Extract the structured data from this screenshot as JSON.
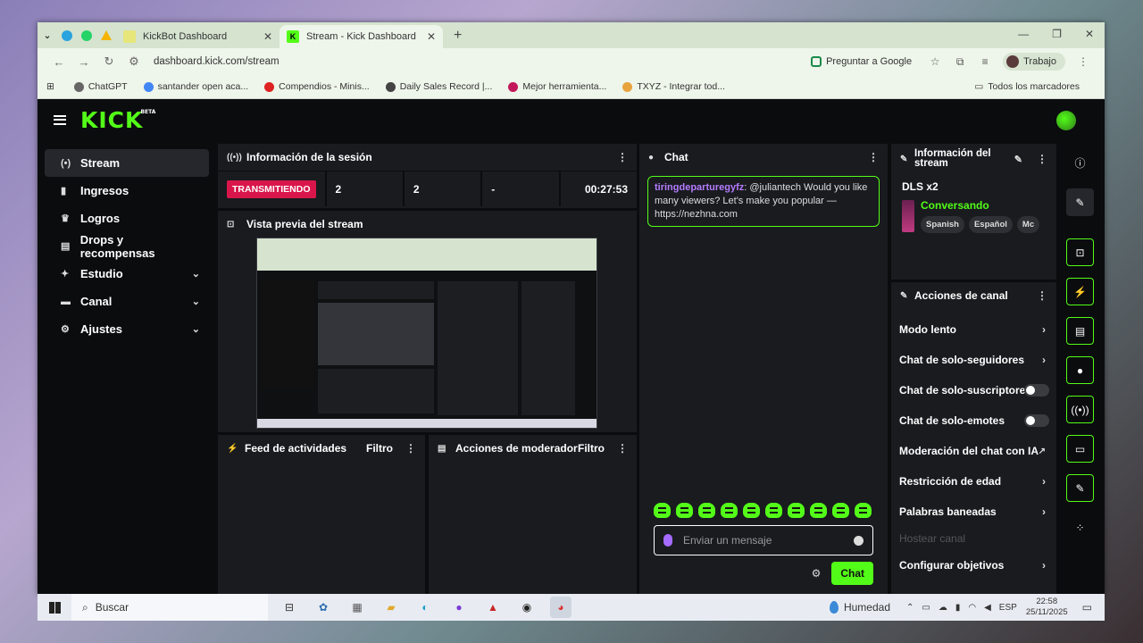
{
  "browser": {
    "tabs": [
      {
        "title": "KickBot Dashboard",
        "active": false
      },
      {
        "title": "Stream - Kick Dashboard",
        "active": true
      }
    ],
    "url": "dashboard.kick.com/stream",
    "ask_google": "Preguntar a Google",
    "profile": "Trabajo",
    "bookmarks": [
      "ChatGPT",
      "santander open aca...",
      "Compendios - Minis...",
      "Daily Sales Record |...",
      "Mejor herramienta...",
      "TXYZ - Integrar tod..."
    ],
    "all_bookmarks": "Todos los marcadores"
  },
  "kick": {
    "logo": "KICK",
    "logo_badge": "BETA",
    "sidebar": [
      {
        "label": "Stream",
        "icon": "broadcast-icon",
        "glyph": "(•)",
        "active": true,
        "expandable": false
      },
      {
        "label": "Ingresos",
        "icon": "chart-icon",
        "glyph": "▮",
        "active": false,
        "expandable": false
      },
      {
        "label": "Logros",
        "icon": "trophy-icon",
        "glyph": "♛",
        "active": false,
        "expandable": false
      },
      {
        "label": "Drops y recompensas",
        "icon": "gift-icon",
        "glyph": "▤",
        "active": false,
        "expandable": false
      },
      {
        "label": "Estudio",
        "icon": "studio-icon",
        "glyph": "✦",
        "active": false,
        "expandable": true
      },
      {
        "label": "Canal",
        "icon": "channel-icon",
        "glyph": "▬",
        "active": false,
        "expandable": true
      },
      {
        "label": "Ajustes",
        "icon": "settings-icon",
        "glyph": "⚙",
        "active": false,
        "expandable": true
      }
    ],
    "session": {
      "title": "Información de la sesión",
      "status": "TRANSMITIENDO",
      "viewers": "2",
      "followers": "2",
      "extra": "-",
      "duration": "00:27:53"
    },
    "preview": {
      "title": "Vista previa del stream"
    },
    "feed": {
      "title": "Feed de actividades",
      "filter": "Filtro"
    },
    "mod_actions": {
      "title": "Acciones de moderador",
      "filter": "Filtro"
    },
    "chat": {
      "title": "Chat",
      "messages": [
        {
          "user": "tiringdeparturegyfz",
          "text": ": @juliantech Would you like many viewers? Let's make you popular — https://nezhna.com"
        }
      ],
      "input_placeholder": "Enviar un mensaje",
      "send_label": "Chat"
    },
    "stream_info": {
      "title": "Información del stream",
      "stream_title": "DLS x2",
      "category": "Conversando",
      "tags": [
        "Spanish",
        "Español",
        "Mc"
      ]
    },
    "channel_actions": {
      "title": "Acciones de canal",
      "items": [
        {
          "label": "Modo lento",
          "control": "chevron"
        },
        {
          "label": "Chat de solo-seguidores",
          "control": "chevron"
        },
        {
          "label": "Chat de solo-suscriptores",
          "control": "toggle"
        },
        {
          "label": "Chat de solo-emotes",
          "control": "toggle"
        },
        {
          "label": "Moderación del chat con IA",
          "control": "external"
        },
        {
          "label": "Restricción de edad",
          "control": "chevron"
        },
        {
          "label": "Palabras baneadas",
          "control": "chevron"
        },
        {
          "label": "Hostear canal",
          "control": "disabled"
        },
        {
          "label": "Configurar objetivos",
          "control": "chevron"
        }
      ]
    }
  },
  "taskbar": {
    "search": "Buscar",
    "weather": "Humedad",
    "lang": "ESP",
    "time": "22:58",
    "date": "25/11/2025"
  }
}
